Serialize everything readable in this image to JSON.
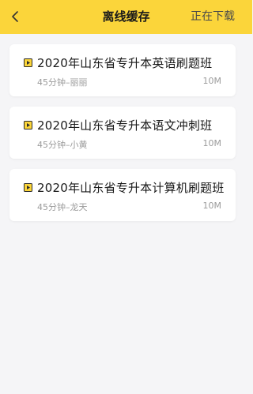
{
  "header": {
    "title": "离线缓存",
    "right_action": "正在下载"
  },
  "colors": {
    "accent": "#fbd53a",
    "background": "#f5f5f7"
  },
  "items": [
    {
      "title": "2020年山东省专升本英语刷题班",
      "subtitle": "45分钟–丽丽",
      "size": "10M",
      "icon": "play-icon"
    },
    {
      "title": "2020年山东省专升本语文冲刺班",
      "subtitle": "45分钟–小黄",
      "size": "10M",
      "icon": "play-icon"
    },
    {
      "title": "2020年山东省专升本计算机刷题班",
      "subtitle": "45分钟–龙天",
      "size": "10M",
      "icon": "play-icon"
    }
  ]
}
